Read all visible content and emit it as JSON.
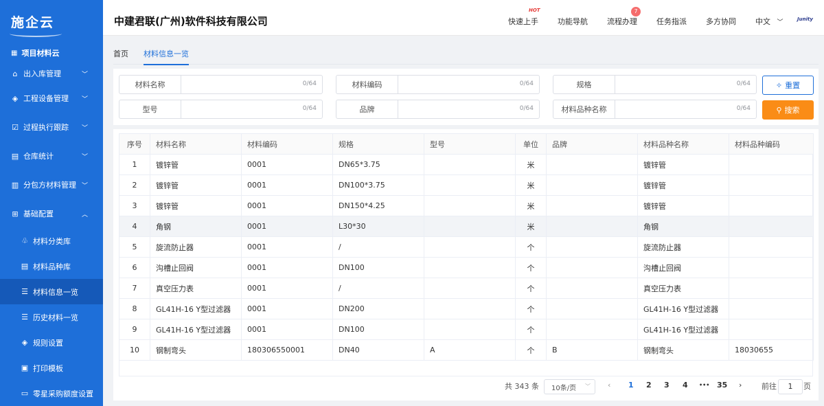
{
  "sidebar": {
    "logo": "施企云",
    "title": "项目材料云",
    "menu": [
      {
        "label": "出入库管理"
      },
      {
        "label": "工程设备管理"
      },
      {
        "label": "过程执行跟踪"
      },
      {
        "label": "仓库统计"
      },
      {
        "label": "分包方材料管理"
      },
      {
        "label": "基础配置"
      }
    ],
    "submenu": [
      {
        "label": "材料分类库"
      },
      {
        "label": "材料品种库"
      },
      {
        "label": "材料信息一览"
      },
      {
        "label": "历史材料一览"
      },
      {
        "label": "规则设置"
      },
      {
        "label": "打印模板"
      },
      {
        "label": "零星采购额度设置"
      }
    ]
  },
  "header": {
    "company": "中建君联(广州)软件科技有限公司",
    "nav": {
      "quick_start": "快速上手",
      "hot": "HOT",
      "function_nav": "功能导航",
      "process": "流程办理",
      "process_count": "7",
      "task": "任务指派",
      "collab": "多方协同",
      "lang": "中文",
      "brand": "Junity"
    }
  },
  "tabs": {
    "home": "首页",
    "current": "材料信息一览"
  },
  "filters": {
    "material_name": {
      "label": "材料名称",
      "value": "",
      "count": "0/64"
    },
    "material_code": {
      "label": "材料编码",
      "value": "",
      "count": "0/64"
    },
    "spec": {
      "label": "规格",
      "value": "",
      "count": "0/64"
    },
    "model": {
      "label": "型号",
      "value": "",
      "count": "0/64"
    },
    "brand": {
      "label": "品牌",
      "value": "",
      "count": "0/64"
    },
    "variety_name": {
      "label": "材料品种名称",
      "value": "",
      "count": "0/64"
    },
    "reset": "重置",
    "search": "搜索"
  },
  "table": {
    "headers": [
      "序号",
      "材料名称",
      "材料编码",
      "规格",
      "型号",
      "单位",
      "品牌",
      "材料品种名称",
      "材料品种编码"
    ],
    "rows": [
      [
        "1",
        "镀锌管",
        "0001",
        "DN65*3.75",
        "",
        "米",
        "",
        "镀锌管",
        ""
      ],
      [
        "2",
        "镀锌管",
        "0001",
        "DN100*3.75",
        "",
        "米",
        "",
        "镀锌管",
        ""
      ],
      [
        "3",
        "镀锌管",
        "0001",
        "DN150*4.25",
        "",
        "米",
        "",
        "镀锌管",
        ""
      ],
      [
        "4",
        "角钢",
        "0001",
        "L30*30",
        "",
        "米",
        "",
        "角钢",
        ""
      ],
      [
        "5",
        "旋流防止器",
        "0001",
        "/",
        "",
        "个",
        "",
        "旋流防止器",
        ""
      ],
      [
        "6",
        "沟槽止回阀",
        "0001",
        "DN100",
        "",
        "个",
        "",
        "沟槽止回阀",
        ""
      ],
      [
        "7",
        "真空压力表",
        "0001",
        "/",
        "",
        "个",
        "",
        "真空压力表",
        ""
      ],
      [
        "8",
        "GL41H-16 Y型过滤器",
        "0001",
        "DN200",
        "",
        "个",
        "",
        "GL41H-16 Y型过滤器",
        ""
      ],
      [
        "9",
        "GL41H-16 Y型过滤器",
        "0001",
        "DN100",
        "",
        "个",
        "",
        "GL41H-16 Y型过滤器",
        ""
      ],
      [
        "10",
        "钢制弯头",
        "180306550001",
        "DN40",
        "A",
        "个",
        "B",
        "钢制弯头",
        "18030655"
      ]
    ]
  },
  "pagination": {
    "total": "共 343 条",
    "page_size": "10条/页",
    "pages": [
      "1",
      "2",
      "3",
      "4",
      "•••",
      "35"
    ],
    "goto_label": "前往",
    "goto_value": "1",
    "page_unit": "页"
  }
}
